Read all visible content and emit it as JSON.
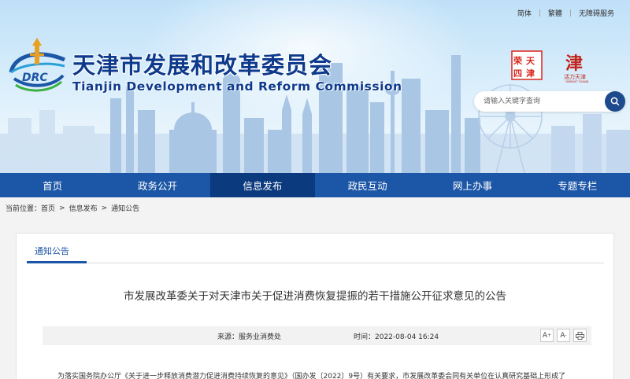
{
  "top_links": [
    "简体",
    "繁體",
    "无障碍服务"
  ],
  "header": {
    "title": "天津市发展和改革委员会",
    "subtitle": "Tianjin Development and Reform Commission",
    "logo_text": "DRC",
    "stamp1_text": "天津 荣登 四",
    "stamp2_text": "天津"
  },
  "search": {
    "placeholder": "请输入关键字查询"
  },
  "nav": [
    {
      "label": "首页",
      "active": false
    },
    {
      "label": "政务公开",
      "active": false
    },
    {
      "label": "信息发布",
      "active": true
    },
    {
      "label": "政民互动",
      "active": false
    },
    {
      "label": "网上办事",
      "active": false
    },
    {
      "label": "专题专栏",
      "active": false
    }
  ],
  "breadcrumb": {
    "prefix": "当前位置：",
    "items": [
      "首页",
      "信息发布",
      "通知公告"
    ],
    "separator": ">"
  },
  "content": {
    "tab_label": "通知公告",
    "article_title": "市发展改革委关于对天津市关于促进消费恢复提振的若干措施公开征求意见的公告",
    "source": "来源：服务业消费处",
    "time": "时间：2022-08-04 16:24",
    "tools": {
      "font_larger": "A",
      "font_smaller": "A",
      "print": "print-icon"
    },
    "body_first_line": "为落实国务院办公厅《关于进一步释放消费潜力促进消费持续恢复的意见》（国办发〔2022〕9号）有关要求，市发展改革委会同有关单位在认真研究基础上形成了"
  },
  "colors": {
    "nav_bg": "#1c56a6",
    "nav_active": "#0b3a7e",
    "title_blue": "#0d3a8c",
    "search_btn": "#1c4a8c"
  }
}
